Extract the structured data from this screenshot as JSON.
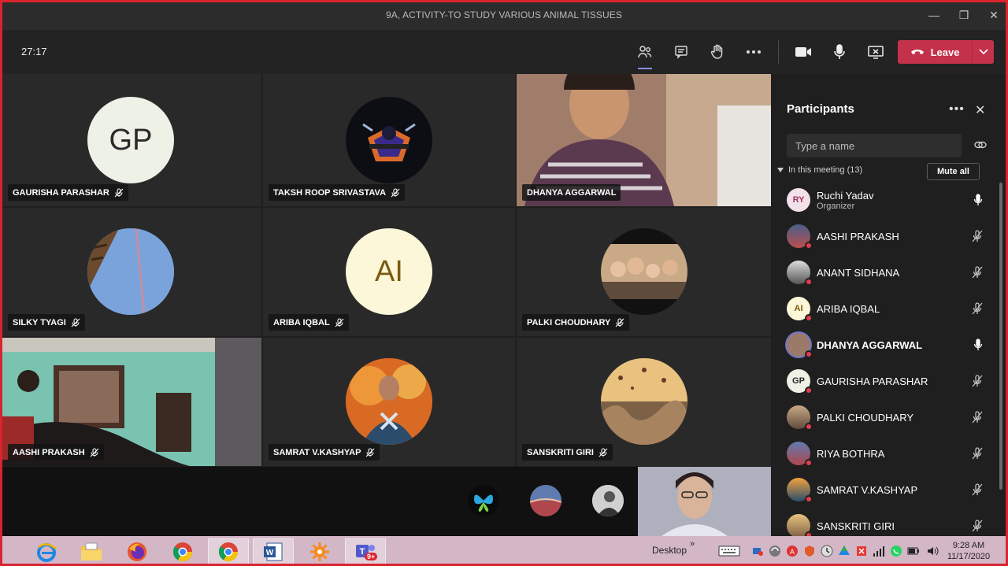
{
  "window": {
    "title": "9A, ACTIVITY-TO STUDY VARIOUS ANIMAL TISSUES"
  },
  "toolbar": {
    "timer": "27:17",
    "leave_label": "Leave"
  },
  "tiles": [
    {
      "name": "GAURISHA PARASHAR",
      "initials": "GP"
    },
    {
      "name": "TAKSH ROOP SRIVASTAVA"
    },
    {
      "name": "DHANYA AGGARWAL"
    },
    {
      "name": "SILKY TYAGI"
    },
    {
      "name": "ARIBA IQBAL",
      "initials": "AI"
    },
    {
      "name": "PALKI CHOUDHARY"
    },
    {
      "name": "AASHI PRAKASH"
    },
    {
      "name": "SAMRAT V.KASHYAP"
    },
    {
      "name": "SANSKRITI GIRI"
    }
  ],
  "panel": {
    "title": "Participants",
    "search_placeholder": "Type a name",
    "section_label": "In this meeting (13)",
    "mute_all": "Mute all",
    "participants": [
      {
        "name": "Ruchi Yadav",
        "role": "Organizer",
        "initials": "RY",
        "mic": "on"
      },
      {
        "name": "AASHI PRAKASH",
        "mic": "off"
      },
      {
        "name": "ANANT SIDHANA",
        "mic": "off"
      },
      {
        "name": "ARIBA IQBAL",
        "initials": "AI",
        "mic": "off"
      },
      {
        "name": "DHANYA AGGARWAL",
        "mic": "on"
      },
      {
        "name": "GAURISHA PARASHAR",
        "initials": "GP",
        "mic": "off"
      },
      {
        "name": "PALKI CHOUDHARY",
        "mic": "off"
      },
      {
        "name": "RIYA BOTHRA",
        "mic": "off"
      },
      {
        "name": "SAMRAT V.KASHYAP",
        "mic": "off"
      },
      {
        "name": "SANSKRITI GIRI",
        "mic": "off"
      }
    ]
  },
  "taskbar": {
    "desktop_label": "Desktop",
    "badge": "9+",
    "time": "9:28 AM",
    "date": "11/17/2020"
  },
  "colors": {
    "accent": "#c4314b",
    "frame": "#d9232e",
    "taskbar": "#d3b7c7"
  }
}
